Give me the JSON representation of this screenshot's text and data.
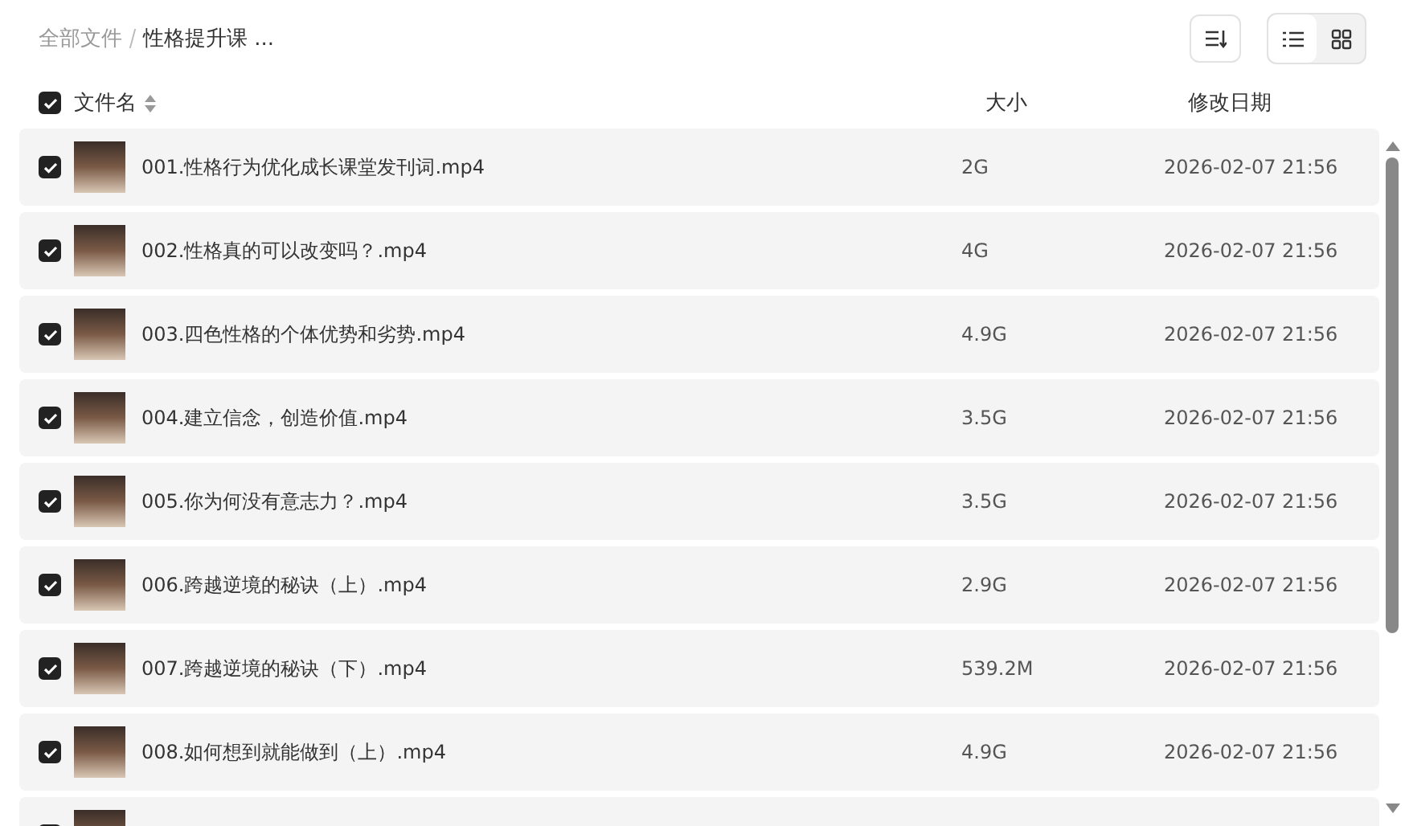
{
  "breadcrumb": [
    {
      "label": "全部文件",
      "current": false
    },
    {
      "label": "性格提升课 ...",
      "current": true
    }
  ],
  "views": [
    {
      "kind": "list",
      "selected": true
    },
    {
      "kind": "grid",
      "selected": false
    }
  ],
  "header": {
    "select_all_checked": true,
    "name": "文件名",
    "size": "大小",
    "date": "修改日期"
  },
  "files": [
    {
      "checked": true,
      "name": "001.性格行为优化成长课堂发刊词.mp4",
      "size": "2G",
      "date": "2026-02-07 21:56"
    },
    {
      "checked": true,
      "name": "002.性格真的可以改变吗？.mp4",
      "size": "4G",
      "date": "2026-02-07 21:56"
    },
    {
      "checked": true,
      "name": "003.四色性格的个体优势和劣势.mp4",
      "size": "4.9G",
      "date": "2026-02-07 21:56"
    },
    {
      "checked": true,
      "name": "004.建立信念，创造价值.mp4",
      "size": "3.5G",
      "date": "2026-02-07 21:56"
    },
    {
      "checked": true,
      "name": "005.你为何没有意志力？.mp4",
      "size": "3.5G",
      "date": "2026-02-07 21:56"
    },
    {
      "checked": true,
      "name": "006.跨越逆境的秘诀（上）.mp4",
      "size": "2.9G",
      "date": "2026-02-07 21:56"
    },
    {
      "checked": true,
      "name": "007.跨越逆境的秘诀（下）.mp4",
      "size": "539.2M",
      "date": "2026-02-07 21:56"
    },
    {
      "checked": true,
      "name": "008.如何想到就能做到（上）.mp4",
      "size": "4.9G",
      "date": "2026-02-07 21:56"
    },
    {
      "checked": true
    }
  ]
}
